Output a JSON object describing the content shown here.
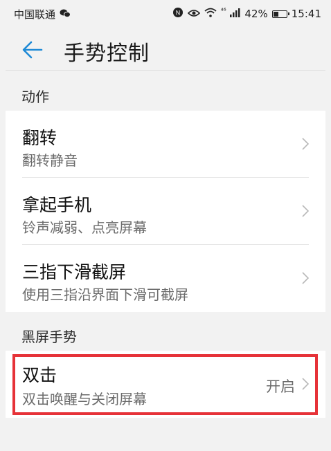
{
  "status_bar": {
    "carrier": "中国联通",
    "network": "⁴⁶",
    "battery_percent": "42%",
    "battery_level": 0.42,
    "time": "15:41"
  },
  "header": {
    "title": "手势控制"
  },
  "sections": [
    {
      "header": "动作",
      "items": [
        {
          "title": "翻转",
          "subtitle": "翻转静音"
        },
        {
          "title": "拿起手机",
          "subtitle": "铃声减弱、点亮屏幕"
        },
        {
          "title": "三指下滑截屏",
          "subtitle": "使用三指沿界面下滑可截屏"
        }
      ]
    },
    {
      "header": "黑屏手势",
      "items": [
        {
          "title": "双击",
          "subtitle": "双击唤醒与关闭屏幕",
          "value": "开启"
        }
      ]
    }
  ],
  "colors": {
    "accent": "#1f8ad6",
    "highlight": "#e63238",
    "background": "#f2f2f2"
  }
}
